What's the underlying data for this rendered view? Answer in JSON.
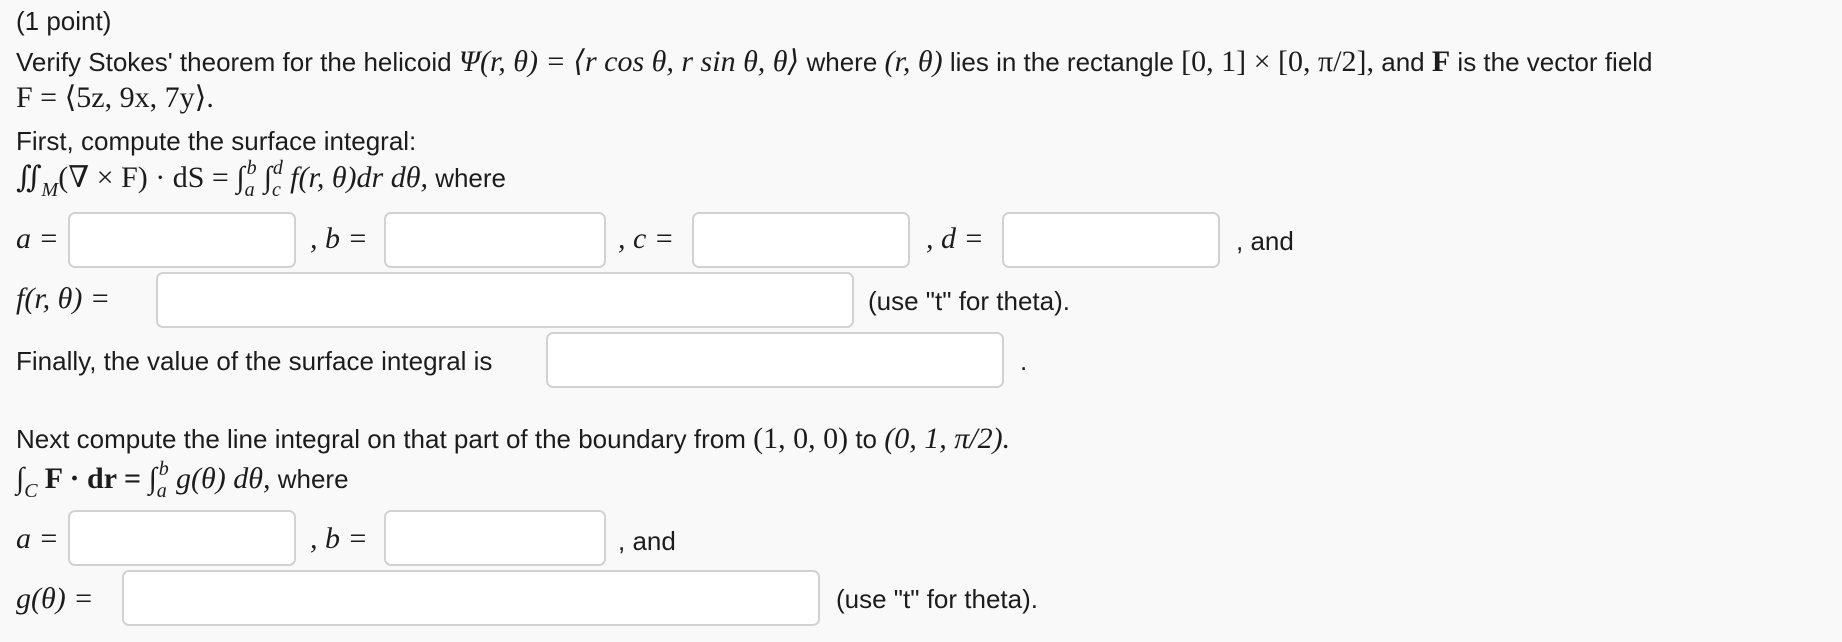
{
  "points": "(1 point)",
  "statement": {
    "verify": "Verify Stokes' theorem for the helicoid",
    "psi": "Ψ(r, θ) = ⟨r cos θ, r sin θ, θ⟩",
    "where": "where",
    "rtheta": "(r, θ)",
    "lies": "lies in the rectangle",
    "rect": "[0, 1] × [0, π/2],",
    "and_F": "and",
    "F": "F",
    "is_field": "is the vector field",
    "F_def": "F = ⟨5z, 9x, 7y⟩."
  },
  "surface": {
    "instruction": "First, compute the surface integral:",
    "integral_lhs": "∬",
    "M": "M",
    "curl": "(∇ × F) · dS = ",
    "int1": "∫",
    "lim_a": "a",
    "lim_b": "b",
    "int2": "∫",
    "lim_c": "c",
    "lim_d": "d",
    "integrand": "f(r, θ)dr dθ,",
    "where": "where",
    "a_label": "a =",
    "b_label": ", b =",
    "c_label": ", c =",
    "d_label": ", d =",
    "and": ", and",
    "f_label": "f(r, θ) =",
    "hint": "(use \"t\" for theta).",
    "final_text": "Finally, the value of the surface integral is",
    "period": "."
  },
  "line": {
    "instruction": "Next compute the line integral on that part of the boundary from",
    "from": "(1, 0, 0)",
    "to_word": "to",
    "to": "(0, 1, π/2).",
    "int": "∫",
    "C": "C",
    "lhs": "F · dr = ",
    "int2": "∫",
    "lim_a": "a",
    "lim_b": "b",
    "integrand": "g(θ) dθ,",
    "where": "where",
    "a_label": "a =",
    "b_label": ", b =",
    "and": ", and",
    "g_label": "g(θ) =",
    "hint": "(use \"t\" for theta)."
  },
  "inputs": {
    "surface_a": "",
    "surface_b": "",
    "surface_c": "",
    "surface_d": "",
    "surface_f": "",
    "surface_value": "",
    "line_a": "",
    "line_b": "",
    "line_g": ""
  }
}
